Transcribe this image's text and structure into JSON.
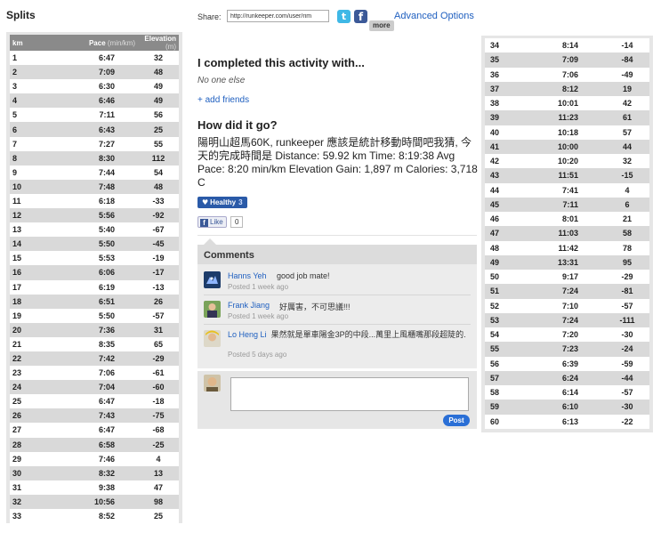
{
  "splits": {
    "title": "Splits",
    "header": {
      "km": "km",
      "pace": "Pace",
      "pace_unit": "(min/km)",
      "elevation": "Elevation",
      "elevation_unit": "(m)"
    },
    "rows_left": [
      [
        "1",
        "6:47",
        "32"
      ],
      [
        "2",
        "7:09",
        "48"
      ],
      [
        "3",
        "6:30",
        "49"
      ],
      [
        "4",
        "6:46",
        "49"
      ],
      [
        "5",
        "7:11",
        "56"
      ],
      [
        "6",
        "6:43",
        "25"
      ],
      [
        "7",
        "7:27",
        "55"
      ],
      [
        "8",
        "8:30",
        "112"
      ],
      [
        "9",
        "7:44",
        "54"
      ],
      [
        "10",
        "7:48",
        "48"
      ],
      [
        "11",
        "6:18",
        "-33"
      ],
      [
        "12",
        "5:56",
        "-92"
      ],
      [
        "13",
        "5:40",
        "-67"
      ],
      [
        "14",
        "5:50",
        "-45"
      ],
      [
        "15",
        "5:53",
        "-19"
      ],
      [
        "16",
        "6:06",
        "-17"
      ],
      [
        "17",
        "6:19",
        "-13"
      ],
      [
        "18",
        "6:51",
        "26"
      ],
      [
        "19",
        "5:50",
        "-57"
      ],
      [
        "20",
        "7:36",
        "31"
      ],
      [
        "21",
        "8:35",
        "65"
      ],
      [
        "22",
        "7:42",
        "-29"
      ],
      [
        "23",
        "7:06",
        "-61"
      ],
      [
        "24",
        "7:04",
        "-60"
      ],
      [
        "25",
        "6:47",
        "-18"
      ],
      [
        "26",
        "7:43",
        "-75"
      ],
      [
        "27",
        "6:47",
        "-68"
      ],
      [
        "28",
        "6:58",
        "-25"
      ],
      [
        "29",
        "7:46",
        "4"
      ],
      [
        "30",
        "8:32",
        "13"
      ],
      [
        "31",
        "9:38",
        "47"
      ],
      [
        "32",
        "10:56",
        "98"
      ],
      [
        "33",
        "8:52",
        "25"
      ]
    ],
    "rows_right": [
      [
        "34",
        "8:14",
        "-14"
      ],
      [
        "35",
        "7:09",
        "-84"
      ],
      [
        "36",
        "7:06",
        "-49"
      ],
      [
        "37",
        "8:12",
        "19"
      ],
      [
        "38",
        "10:01",
        "42"
      ],
      [
        "39",
        "11:23",
        "61"
      ],
      [
        "40",
        "10:18",
        "57"
      ],
      [
        "41",
        "10:00",
        "44"
      ],
      [
        "42",
        "10:20",
        "32"
      ],
      [
        "43",
        "11:51",
        "-15"
      ],
      [
        "44",
        "7:41",
        "4"
      ],
      [
        "45",
        "7:11",
        "6"
      ],
      [
        "46",
        "8:01",
        "21"
      ],
      [
        "47",
        "11:03",
        "58"
      ],
      [
        "48",
        "11:42",
        "78"
      ],
      [
        "49",
        "13:31",
        "95"
      ],
      [
        "50",
        "9:17",
        "-29"
      ],
      [
        "51",
        "7:24",
        "-81"
      ],
      [
        "52",
        "7:10",
        "-57"
      ],
      [
        "53",
        "7:24",
        "-111"
      ],
      [
        "54",
        "7:20",
        "-30"
      ],
      [
        "55",
        "7:23",
        "-24"
      ],
      [
        "56",
        "6:39",
        "-59"
      ],
      [
        "57",
        "6:24",
        "-44"
      ],
      [
        "58",
        "6:14",
        "-57"
      ],
      [
        "59",
        "6:10",
        "-30"
      ],
      [
        "60",
        "6:13",
        "-22"
      ]
    ]
  },
  "share": {
    "label": "Share:",
    "url": "http://runkeeper.com/user/rim",
    "twitter_glyph": "t",
    "facebook_glyph": "f",
    "more_label": "more",
    "advanced_label": "Advanced Options"
  },
  "activity": {
    "completed_heading": "I completed this activity with...",
    "no_one": "No one else",
    "add_friends": "+ add friends",
    "how_heading": "How did it go?",
    "description": "陽明山超馬60K, runkeeper 應該是統計移動時間吧我猜, 今天的完成時間是 Distance: 59.92 km Time: 8:19:38 Avg Pace: 8:20 min/km Elevation Gain: 1,897 m Calories: 3,718 C",
    "healthy_label": "Healthy",
    "healthy_count": "3",
    "like_label": "Like",
    "like_count": "0"
  },
  "comments": {
    "title": "Comments",
    "items": [
      {
        "author": "Hanns Yeh",
        "text": "good job mate!",
        "time": "Posted 1 week ago"
      },
      {
        "author": "Frank Jiang",
        "text": "好厲害，不可思議!!!",
        "time": "Posted 1 week ago"
      },
      {
        "author": "Lo Heng Li",
        "text": "果然就是單車陽金3P的中段...萬里上風櫃嘴那段超陡的.",
        "time": "Posted 5 days ago"
      }
    ],
    "post_label": "Post"
  },
  "colors": {
    "link": "#2060c0",
    "table_header": "#8a8a8a",
    "row_alt": "#d9d9d9",
    "panel_bg": "#e6e6e6",
    "twitter": "#3fb8e6",
    "facebook": "#3b5998",
    "post_button": "#2a6fd6"
  },
  "icons": {
    "heart": "heart-icon",
    "twitter": "twitter-icon",
    "facebook": "facebook-icon"
  }
}
